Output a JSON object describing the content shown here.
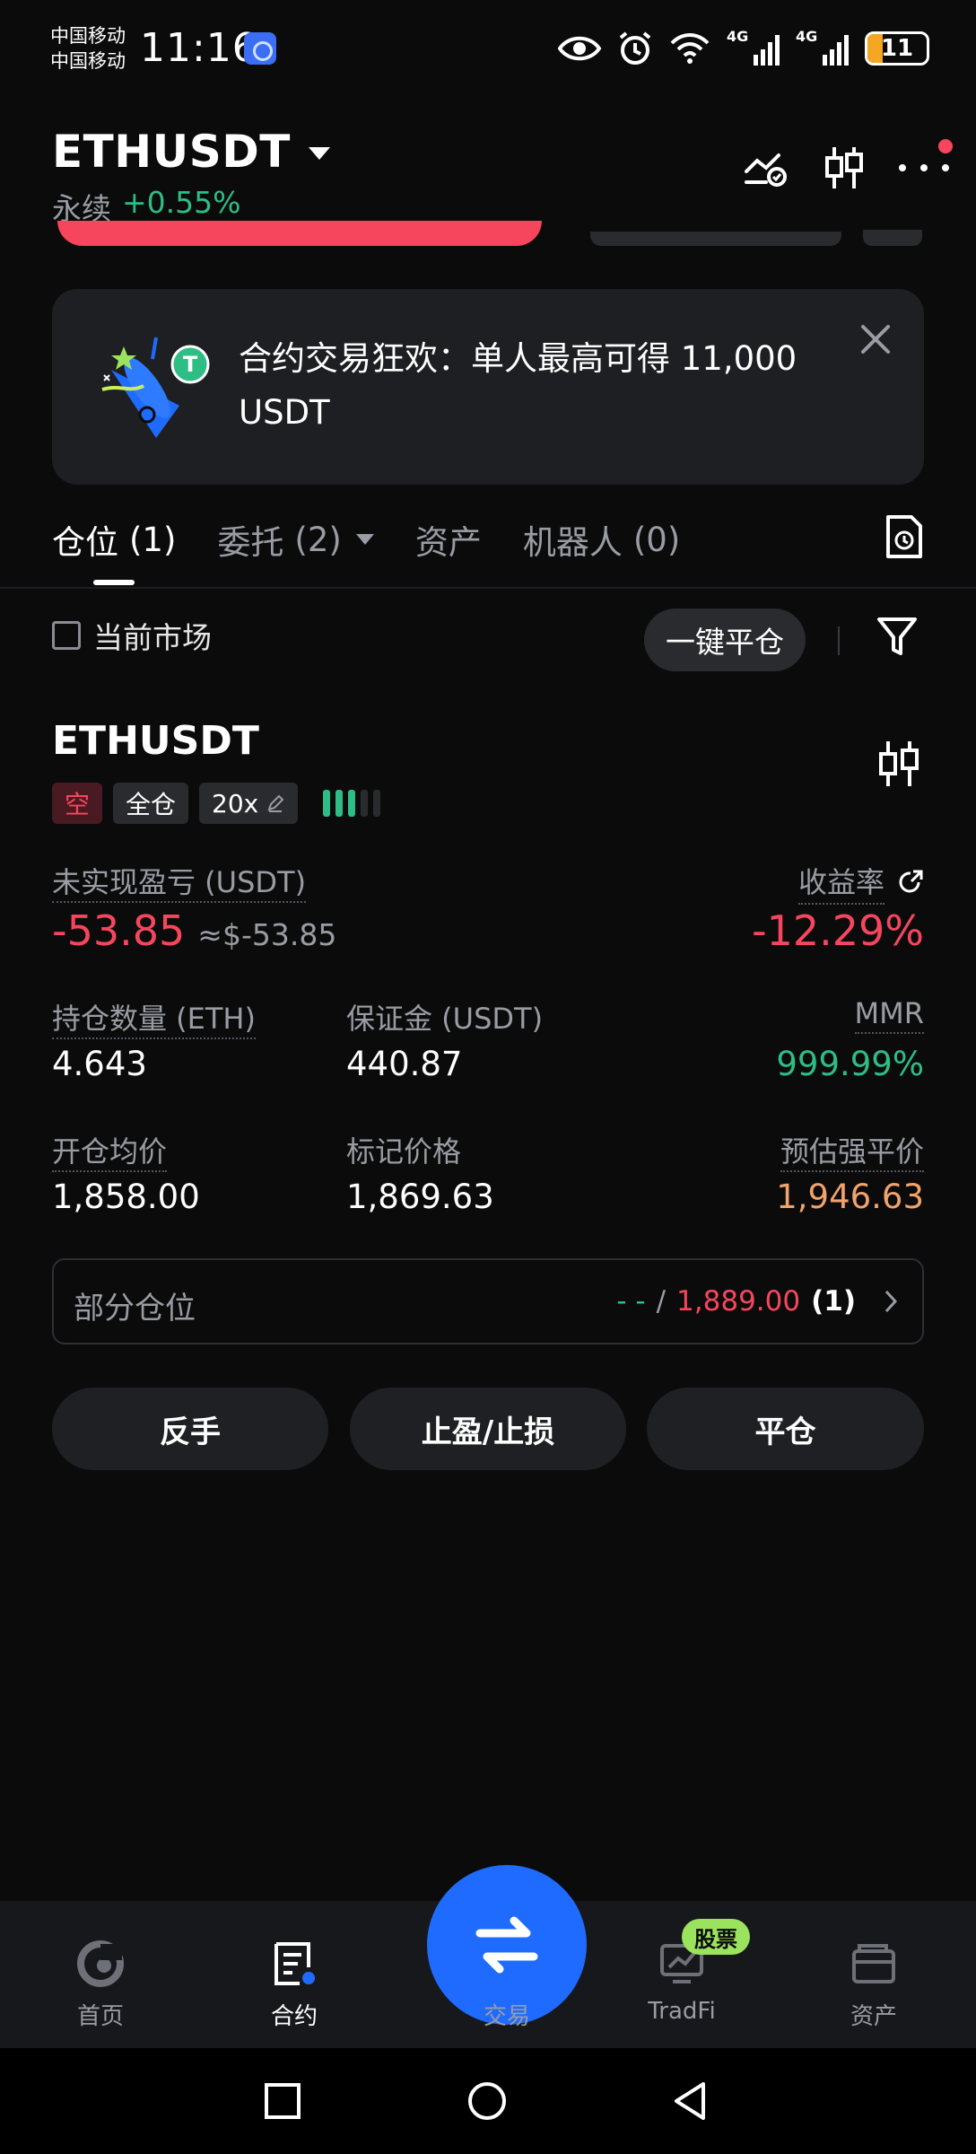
{
  "status_bar": {
    "carrier_1": "中国移动",
    "carrier_2": "中国移动",
    "time": "11:16",
    "battery": "11",
    "battery_level": 0.11,
    "net_1": "4G",
    "net_2": "4G"
  },
  "header": {
    "symbol": "ETHUSDT",
    "contract_type": "永续",
    "change": "+0.55%"
  },
  "banner": {
    "text": "合约交易狂欢：单人最高可得 11,000 USDT"
  },
  "tabs": [
    {
      "label": "仓位",
      "count": "(1)"
    },
    {
      "label": "委托",
      "count": "(2)"
    },
    {
      "label": "资产",
      "count": ""
    },
    {
      "label": "机器人",
      "count": "(0)"
    }
  ],
  "filter": {
    "current_market_label": "当前市场",
    "close_all_label": "一键平仓"
  },
  "position": {
    "symbol": "ETHUSDT",
    "side": "空",
    "margin_mode": "全仓",
    "leverage": "20x",
    "unrealized_pnl_label": "未实现盈亏 (USDT)",
    "unrealized_pnl": "-53.85",
    "unrealized_pnl_usd": "≈$-53.85",
    "roe_label": "收益率",
    "roe": "-12.29%",
    "size_label": "持仓数量 (ETH)",
    "size": "4.643",
    "margin_label": "保证金 (USDT)",
    "margin": "440.87",
    "mmr_label": "MMR",
    "mmr": "999.99%",
    "entry_price_label": "开仓均价",
    "entry_price": "1,858.00",
    "mark_price_label": "标记价格",
    "mark_price": "1,869.63",
    "liq_price_label": "预估强平价",
    "liq_price": "1,946.63",
    "partial_label": "部分仓位",
    "partial_tp": "- -",
    "partial_sep": "/",
    "partial_sl": "1,889.00",
    "partial_count": "(1)",
    "risk_level": 3
  },
  "actions": {
    "reverse": "反手",
    "tpsl": "止盈/止损",
    "close": "平仓"
  },
  "bottom_nav": {
    "home": "首页",
    "futures": "合约",
    "trade": "交易",
    "tradfi": "TradFi",
    "tradfi_badge": "股票",
    "assets": "资产"
  },
  "colors": {
    "accent_blue": "#1f6bff",
    "up_green": "#2ebd85",
    "down_red": "#f6465d",
    "liq_orange": "#f0a36b",
    "badge_green": "#9be35f"
  }
}
